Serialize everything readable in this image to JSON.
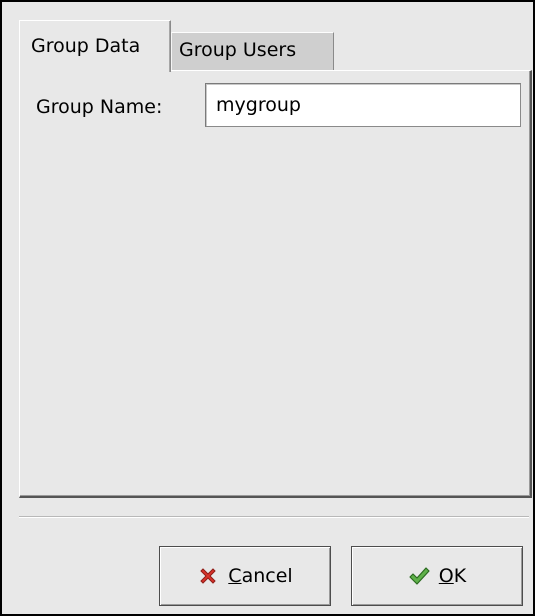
{
  "tabs": {
    "group_data": "Group Data",
    "group_users": "Group Users"
  },
  "form": {
    "group_name_label": "Group Name:",
    "group_name_value": "mygroup"
  },
  "buttons": {
    "cancel": {
      "mnemonic": "C",
      "rest": "ancel",
      "icon": "cancel-x-icon"
    },
    "ok": {
      "mnemonic": "O",
      "rest": "K",
      "icon": "checkmark-icon"
    }
  },
  "colors": {
    "dialog_bg": "#e8e8e8",
    "inactive_tab_bg": "#cfcfcf",
    "cancel_icon": "#d9332b",
    "ok_icon": "#3c8a2e"
  }
}
